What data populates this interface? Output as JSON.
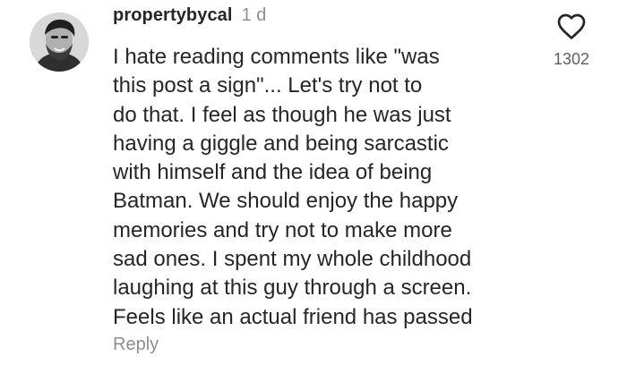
{
  "comment": {
    "username": "propertybycal",
    "time": "1 d",
    "text": "I hate reading comments like \"was\nthis post a sign\"... Let's try not to\ndo that. I feel as though he was just\nhaving a giggle and being sarcastic\nwith himself and the idea of being\nBatman. We should enjoy the happy\nmemories and try not to make more\nsad ones. I spent my whole childhood\nlaughing at this guy through a screen.\nFeels like an actual friend has passed",
    "reply_label": "Reply",
    "likes": "1302",
    "avatar_icon": "profile-photo",
    "like_icon": "heart-outline-icon"
  },
  "colors": {
    "text": "#262626",
    "muted": "#8e8e8e",
    "background": "#ffffff"
  }
}
